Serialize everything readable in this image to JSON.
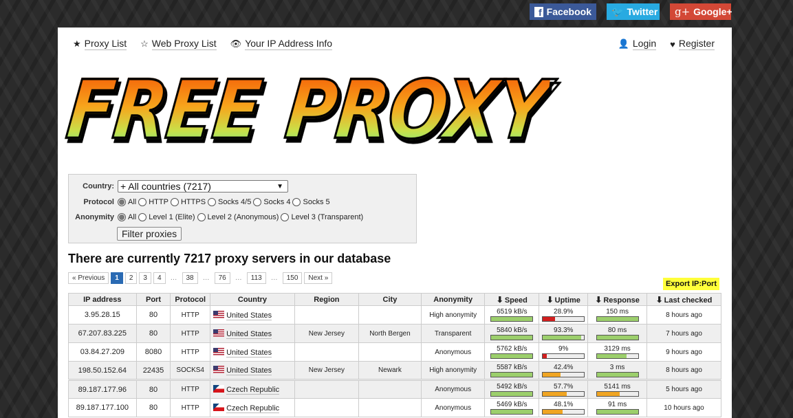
{
  "social": {
    "facebook": "Facebook",
    "twitter": "Twitter",
    "googleplus": "Google+"
  },
  "nav": {
    "left": [
      {
        "label": "Proxy List",
        "icon": "star-solid-icon"
      },
      {
        "label": "Web Proxy List",
        "icon": "star-outline-icon"
      },
      {
        "label": "Your IP Address Info",
        "icon": "eye-icon"
      }
    ],
    "right": [
      {
        "label": "Login",
        "icon": "user-icon"
      },
      {
        "label": "Register",
        "icon": "heart-icon"
      }
    ]
  },
  "logo": {
    "word1": "FREE",
    "word2": "PROXY"
  },
  "filter": {
    "country_label": "Country:",
    "country_value": "+ All countries (7217)",
    "protocol_label": "Protocol",
    "protocol_options": [
      "All",
      "HTTP",
      "HTTPS",
      "Socks 4/5",
      "Socks 4",
      "Socks 5"
    ],
    "protocol_selected": "All",
    "anonymity_label": "Anonymity",
    "anonymity_options": [
      "All",
      "Level 1 (Elite)",
      "Level 2 (Anonymous)",
      "Level 3 (Transparent)"
    ],
    "anonymity_selected": "All",
    "button": "Filter proxies"
  },
  "heading": "There are currently 7217 proxy servers in our database",
  "pager": {
    "previous": "« Previous",
    "next": "Next »",
    "pages": [
      "1",
      "2",
      "3",
      "4",
      "…",
      "38",
      "…",
      "76",
      "…",
      "113",
      "…",
      "150"
    ],
    "active": "1"
  },
  "export_label": "Export IP:Port",
  "colors": {
    "bar_good": "#9ccf6c",
    "bar_mid": "#f0a523",
    "bar_bad": "#d21e1e",
    "pager_active": "#2a6ab3",
    "export_bg": "#ffff3a"
  },
  "table": {
    "headers": [
      "IP address",
      "Port",
      "Protocol",
      "Country",
      "Region",
      "City",
      "Anonymity",
      "Speed",
      "Uptime",
      "Response",
      "Last checked"
    ],
    "rows": [
      {
        "ip": "3.95.28.15",
        "port": "80",
        "protocol": "HTTP",
        "flag": "us",
        "country": "United States",
        "region": "",
        "city": "",
        "anonymity": "High anonymity",
        "speed": "6519 kB/s",
        "speed_pct": 100,
        "speed_level": "good",
        "uptime": "28.9%",
        "uptime_pct": 28.9,
        "uptime_level": "bad",
        "response": "150 ms",
        "response_pct": 100,
        "response_level": "good",
        "checked": "8 hours ago"
      },
      {
        "ip": "67.207.83.225",
        "port": "80",
        "protocol": "HTTP",
        "flag": "us",
        "country": "United States",
        "region": "New Jersey",
        "city": "North Bergen",
        "anonymity": "Transparent",
        "speed": "5840 kB/s",
        "speed_pct": 100,
        "speed_level": "good",
        "uptime": "93.3%",
        "uptime_pct": 93.3,
        "uptime_level": "good",
        "response": "80 ms",
        "response_pct": 100,
        "response_level": "good",
        "checked": "7 hours ago"
      },
      {
        "ip": "03.84.27.209",
        "port": "8080",
        "protocol": "HTTP",
        "flag": "us",
        "country": "United States",
        "region": "",
        "city": "",
        "anonymity": "Anonymous",
        "speed": "5762 kB/s",
        "speed_pct": 100,
        "speed_level": "good",
        "uptime": "9%",
        "uptime_pct": 9,
        "uptime_level": "bad",
        "response": "3129 ms",
        "response_pct": 72,
        "response_level": "good",
        "checked": "9 hours ago"
      },
      {
        "ip": "198.50.152.64",
        "port": "22435",
        "protocol": "SOCKS4",
        "flag": "us",
        "country": "United States",
        "region": "New Jersey",
        "city": "Newark",
        "anonymity": "High anonymity",
        "speed": "5587 kB/s",
        "speed_pct": 100,
        "speed_level": "good",
        "uptime": "42.4%",
        "uptime_pct": 42.4,
        "uptime_level": "mid",
        "response": "3 ms",
        "response_pct": 100,
        "response_level": "good",
        "checked": "8 hours ago"
      },
      {
        "ip": "89.187.177.96",
        "port": "80",
        "protocol": "HTTP",
        "flag": "cz",
        "country": "Czech Republic",
        "region": "",
        "city": "",
        "anonymity": "Anonymous",
        "speed": "5492 kB/s",
        "speed_pct": 100,
        "speed_level": "good",
        "uptime": "57.7%",
        "uptime_pct": 57.7,
        "uptime_level": "mid",
        "response": "5141 ms",
        "response_pct": 56,
        "response_level": "mid",
        "checked": "5 hours ago"
      },
      {
        "ip": "89.187.177.100",
        "port": "80",
        "protocol": "HTTP",
        "flag": "cz",
        "country": "Czech Republic",
        "region": "",
        "city": "",
        "anonymity": "Anonymous",
        "speed": "5469 kB/s",
        "speed_pct": 100,
        "speed_level": "good",
        "uptime": "48.1%",
        "uptime_pct": 48.1,
        "uptime_level": "mid",
        "response": "91 ms",
        "response_pct": 100,
        "response_level": "good",
        "checked": "10 hours ago"
      }
    ]
  }
}
